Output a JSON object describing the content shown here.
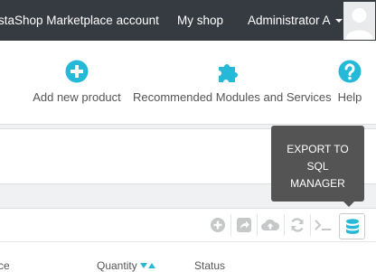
{
  "topbar": {
    "marketplace_label": "staShop Marketplace account",
    "myshop_label": "My shop",
    "admin_label": "Administrator A"
  },
  "toolbar": {
    "add_product_label": "Add new product",
    "recommended_label": "Recommended Modules and Services",
    "help_label": "Help"
  },
  "tooltip": {
    "line1": "EXPORT TO",
    "line2": "SQL",
    "line3": "MANAGER"
  },
  "table": {
    "col_partial": "ce",
    "col_quantity": "Quantity",
    "col_status": "Status"
  },
  "colors": {
    "accent": "#25b9d7",
    "topbar_bg": "#363a41",
    "icon_grey": "#c5c7c9"
  },
  "icons": [
    "plus-circle-icon",
    "puzzle-icon",
    "question-circle-icon",
    "add-circle-icon",
    "share-icon",
    "cloud-upload-icon",
    "refresh-icon",
    "terminal-icon",
    "database-icon",
    "user-avatar-icon"
  ]
}
